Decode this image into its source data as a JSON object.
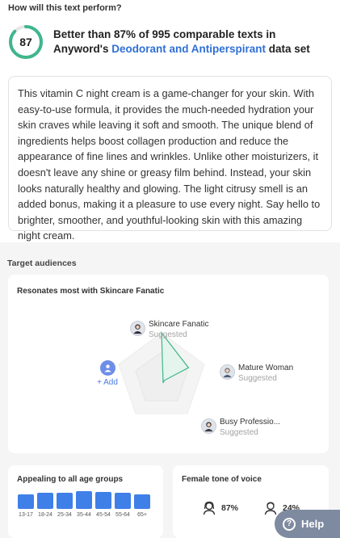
{
  "header": {
    "title": "How will this text perform?"
  },
  "score": {
    "value": "87",
    "fraction": 0.87,
    "color": "#3fb68b",
    "line1": "Better than 87% of 995 comparable texts in",
    "line2_prefix": "Anyword's ",
    "line2_link": "Deodorant and Antiperspirant",
    "line2_suffix": " data set"
  },
  "text_body": "This vitamin C night cream is a game-changer for your skin. With easy-to-use formula, it provides the much-needed hydration your skin craves while leaving it soft and smooth. The unique blend of ingredients helps boost collagen production and reduce the appearance of fine lines and wrinkles. Unlike other moisturizers, it doesn't leave any shine or greasy film behind. Instead, your skin looks naturally healthy and glowing. The light citrusy smell is an added bonus, making it a pleasure to use every night. Say hello to brighter, smoother, and youthful-looking skin with this amazing night cream.",
  "audiences": {
    "section_label": "Target audiences",
    "card_title": "Resonates most with Skincare Fanatic",
    "add_label": "+ Add",
    "personas": [
      {
        "name": "Skincare Fanatic",
        "status": "Suggested",
        "icon": "woman-avatar-icon",
        "level": 1.0
      },
      {
        "name": "Mature Woman",
        "status": "Suggested",
        "icon": "woman-avatar-icon",
        "level": 0.65
      },
      {
        "name": "Busy Professio...",
        "status": "Suggested",
        "icon": "woman-avatar-icon",
        "level": 0.0
      }
    ],
    "accent_color": "#3fb68b"
  },
  "age_groups": {
    "title": "Appealing to all age groups",
    "bar_color": "#3f7fe8",
    "chart_data": {
      "type": "bar",
      "categories": [
        "13-17",
        "18-24",
        "25-34",
        "35-44",
        "45-54",
        "55-64",
        "65+"
      ],
      "values": [
        0.75,
        0.85,
        0.85,
        0.92,
        0.88,
        0.82,
        0.75
      ]
    }
  },
  "tone": {
    "title": "Female tone of voice",
    "female_value": "87%",
    "male_value": "24%",
    "female_icon": "female-icon",
    "male_icon": "male-icon"
  },
  "help": {
    "label": "Help",
    "icon": "question-icon"
  }
}
